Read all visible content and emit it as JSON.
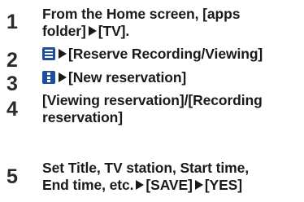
{
  "steps": [
    {
      "number": "1",
      "lines": [
        "From the Home screen, [apps",
        "folder]"
      ],
      "after_arrow": "[TV]."
    },
    {
      "number": "2",
      "icon": "menu-icon",
      "after_arrow": "[Reserve Recording/Viewing]"
    },
    {
      "number": "3",
      "icon": "more-vertical-icon",
      "after_arrow": "[New reservation]"
    },
    {
      "number": "4",
      "lines": [
        "[Viewing reservation]/[Recording",
        "reservation]"
      ]
    },
    {
      "number": "5",
      "lines": [
        "Set Title, TV station, Start time,",
        "End time, etc."
      ],
      "after_arrow_1": "[SAVE]",
      "after_arrow_2": "[YES]"
    }
  ],
  "colors": {
    "text": "#1a1a1a",
    "icon_bg": "#1f4e9c"
  }
}
